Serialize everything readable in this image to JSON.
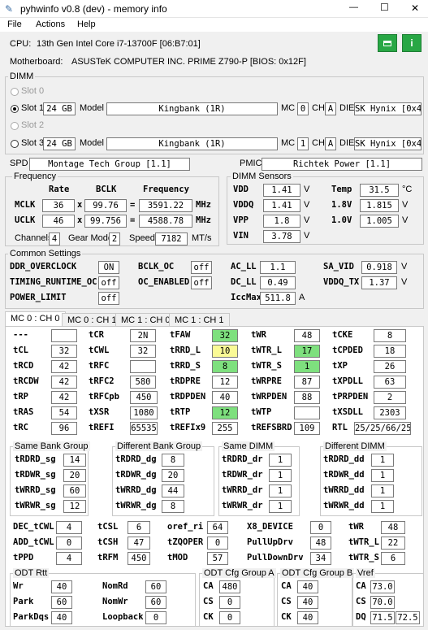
{
  "window": {
    "title": "pyhwinfo v0.8 (dev) - memory info",
    "minimize": "—",
    "maximize": "☐",
    "close": "✕"
  },
  "menu": [
    "File",
    "Actions",
    "Help"
  ],
  "cpu": {
    "label": "CPU:",
    "value": "13th Gen Intel Core i7-13700F  [06:B7:01]"
  },
  "motherboard": {
    "label": "Motherboard:",
    "value": "ASUSTeK COMPUTER INC. PRIME Z790-P  [BIOS: 0x12F]"
  },
  "toolbar": {
    "save_icon": "save-icon",
    "info_icon": "info-icon",
    "accent": "#28a745"
  },
  "dimm": {
    "title": "DIMM",
    "slots": [
      {
        "label": "Slot 0",
        "enabled": false
      },
      {
        "label": "Slot 1",
        "enabled": true,
        "selected": true,
        "size": "24 GB",
        "model_label": "Model",
        "model": "Kingbank          (1R)",
        "mc_label": "MC",
        "mc": "0",
        "ch_label": "CH",
        "ch": "A",
        "die_label": "DIE",
        "die": "SK Hynix [0x4D]"
      },
      {
        "label": "Slot 2",
        "enabled": false
      },
      {
        "label": "Slot 3",
        "enabled": true,
        "selected": false,
        "size": "24 GB",
        "model_label": "Model",
        "model": "Kingbank          (1R)",
        "mc_label": "MC",
        "mc": "1",
        "ch_label": "CH",
        "ch": "A",
        "die_label": "DIE",
        "die": "SK Hynix [0x4D]"
      }
    ]
  },
  "spd": {
    "label": "SPD",
    "value": "Montage Tech Group [1.1]"
  },
  "pmic": {
    "label": "PMIC",
    "value": "Richtek Power [1.1]"
  },
  "frequency": {
    "title": "Frequency",
    "col_rate": "Rate",
    "col_bclk": "BCLK",
    "col_freq": "Frequency",
    "rows": [
      {
        "label": "MCLK",
        "rate": "36",
        "x": "x",
        "bclk": "99.76",
        "eq": "=",
        "freq": "3591.22",
        "unit": "MHz"
      },
      {
        "label": "UCLK",
        "rate": "46",
        "x": "x",
        "bclk": "99.756",
        "eq": "=",
        "freq": "4588.78",
        "unit": "MHz"
      }
    ],
    "channels_label": "Channels",
    "channels": "4",
    "gear_label": "Gear Mode",
    "gear": "2",
    "speed_label": "Speed",
    "speed": "7182",
    "speed_unit": "MT/s"
  },
  "sensors": {
    "title": "DIMM Sensors",
    "items": [
      {
        "label": "VDD",
        "value": "1.41",
        "unit": "V"
      },
      {
        "label": "Temp",
        "value": "31.5",
        "unit": "°C"
      },
      {
        "label": "VDDQ",
        "value": "1.41",
        "unit": "V"
      },
      {
        "label": "1.8V",
        "value": "1.815",
        "unit": "V"
      },
      {
        "label": "VPP",
        "value": "1.8",
        "unit": "V"
      },
      {
        "label": "1.0V",
        "value": "1.005",
        "unit": "V"
      },
      {
        "label": "VIN",
        "value": "3.78",
        "unit": "V"
      }
    ]
  },
  "common": {
    "title": "Common Settings",
    "items": [
      {
        "label": "DDR_OVERCLOCK",
        "value": "ON"
      },
      {
        "label": "BCLK_OC",
        "value": "off"
      },
      {
        "label": "AC_LL",
        "value": "1.1"
      },
      {
        "label": "SA_VID",
        "value": "0.918",
        "unit": "V"
      },
      {
        "label": "TIMING_RUNTIME_OC",
        "value": "off"
      },
      {
        "label": "OC_ENABLED",
        "value": "off"
      },
      {
        "label": "DC_LL",
        "value": "0.49"
      },
      {
        "label": "VDDQ_TX",
        "value": "1.37",
        "unit": "V"
      },
      {
        "label": "POWER_LIMIT",
        "value": "off"
      },
      {
        "label": "IccMax",
        "value": "511.8",
        "unit": "A"
      }
    ]
  },
  "tabs": [
    "MC 0 : CH 0",
    "MC 0 : CH 1",
    "MC 1 : CH 0",
    "MC 1 : CH 1"
  ],
  "timings": [
    [
      {
        "l": "---",
        "v": ""
      },
      {
        "l": "tCR",
        "v": "2N"
      },
      {
        "l": "tFAW",
        "v": "32",
        "c": "g"
      },
      {
        "l": "tWR",
        "v": "48"
      },
      {
        "l": "tCKE",
        "v": "8"
      }
    ],
    [
      {
        "l": "tCL",
        "v": "32"
      },
      {
        "l": "tCWL",
        "v": "32"
      },
      {
        "l": "tRRD_L",
        "v": "10",
        "c": "y"
      },
      {
        "l": "tWTR_L",
        "v": "17",
        "c": "g"
      },
      {
        "l": "tCPDED",
        "v": "18"
      }
    ],
    [
      {
        "l": "tRCD",
        "v": "42"
      },
      {
        "l": "tRFC",
        "v": ""
      },
      {
        "l": "tRRD_S",
        "v": "8",
        "c": "g"
      },
      {
        "l": "tWTR_S",
        "v": "1",
        "c": "g"
      },
      {
        "l": "tXP",
        "v": "26"
      }
    ],
    [
      {
        "l": "tRCDW",
        "v": "42"
      },
      {
        "l": "tRFC2",
        "v": "580"
      },
      {
        "l": "tRDPRE",
        "v": "12"
      },
      {
        "l": "tWRPRE",
        "v": "87"
      },
      {
        "l": "tXPDLL",
        "v": "63"
      }
    ],
    [
      {
        "l": "tRP",
        "v": "42"
      },
      {
        "l": "tRFCpb",
        "v": "450"
      },
      {
        "l": "tRDPDEN",
        "v": "40"
      },
      {
        "l": "tWRPDEN",
        "v": "88"
      },
      {
        "l": "tPRPDEN",
        "v": "2"
      }
    ],
    [
      {
        "l": "tRAS",
        "v": "54"
      },
      {
        "l": "tXSR",
        "v": "1080"
      },
      {
        "l": "tRTP",
        "v": "12",
        "c": "g"
      },
      {
        "l": "tWTP",
        "v": ""
      },
      {
        "l": "tXSDLL",
        "v": "2303"
      }
    ],
    [
      {
        "l": "tRC",
        "v": "96"
      },
      {
        "l": "tREFI",
        "v": "65535"
      },
      {
        "l": "tREFIx9",
        "v": "255"
      },
      {
        "l": "tREFSBRD",
        "v": "109"
      },
      {
        "l": "RTL",
        "v": "25/25/66/25"
      }
    ]
  ],
  "sbg": {
    "title": "Same Bank Group",
    "items": [
      {
        "l": "tRDRD_sg",
        "v": "14"
      },
      {
        "l": "tRDWR_sg",
        "v": "20"
      },
      {
        "l": "tWRRD_sg",
        "v": "60"
      },
      {
        "l": "tWRWR_sg",
        "v": "12"
      }
    ]
  },
  "dbg": {
    "title": "Different Bank Group",
    "items": [
      {
        "l": "tRDRD_dg",
        "v": "8"
      },
      {
        "l": "tRDWR_dg",
        "v": "20"
      },
      {
        "l": "tWRRD_dg",
        "v": "44"
      },
      {
        "l": "tWRWR_dg",
        "v": "8"
      }
    ]
  },
  "sdimm": {
    "title": "Same DIMM",
    "items": [
      {
        "l": "tRDRD_dr",
        "v": "1"
      },
      {
        "l": "tRDWR_dr",
        "v": "1"
      },
      {
        "l": "tWRRD_dr",
        "v": "1"
      },
      {
        "l": "tWRWR_dr",
        "v": "1"
      }
    ]
  },
  "ddimm": {
    "title": "Different DIMM",
    "items": [
      {
        "l": "tRDRD_dd",
        "v": "1"
      },
      {
        "l": "tRDWR_dd",
        "v": "1"
      },
      {
        "l": "tWRRD_dd",
        "v": "1"
      },
      {
        "l": "tWRWR_dd",
        "v": "1"
      }
    ]
  },
  "misc": [
    [
      {
        "l": "DEC_tCWL",
        "v": "4"
      },
      {
        "l": "tCSL",
        "v": "6"
      },
      {
        "l": "oref_ri",
        "v": "64"
      },
      {
        "l": "X8_DEVICE",
        "v": "0"
      },
      {
        "l": "tWR",
        "v": "48"
      }
    ],
    [
      {
        "l": "ADD_tCWL",
        "v": "0"
      },
      {
        "l": "tCSH",
        "v": "47"
      },
      {
        "l": "tZQOPER",
        "v": "0"
      },
      {
        "l": "PullUpDrv",
        "v": "48"
      },
      {
        "l": "tWTR_L",
        "v": "22"
      }
    ],
    [
      {
        "l": "tPPD",
        "v": "4"
      },
      {
        "l": "tRFM",
        "v": "450"
      },
      {
        "l": "tMOD",
        "v": "57"
      },
      {
        "l": "PullDownDrv",
        "v": "34"
      },
      {
        "l": "tWTR_S",
        "v": "6"
      }
    ]
  ],
  "odt_rtt": {
    "title": "ODT Rtt",
    "items": [
      {
        "l": "Wr",
        "v": "40"
      },
      {
        "l": "NomRd",
        "v": "60"
      },
      {
        "l": "Park",
        "v": "60"
      },
      {
        "l": "NomWr",
        "v": "60"
      },
      {
        "l": "ParkDqs",
        "v": "40"
      },
      {
        "l": "Loopback",
        "v": "0"
      }
    ]
  },
  "odt_a": {
    "title": "ODT Cfg Group A",
    "items": [
      {
        "l": "CA",
        "v": "480"
      },
      {
        "l": "CS",
        "v": "0"
      },
      {
        "l": "CK",
        "v": "0"
      }
    ]
  },
  "odt_b": {
    "title": "ODT Cfg Group B",
    "items": [
      {
        "l": "CA",
        "v": "40"
      },
      {
        "l": "CS",
        "v": "40"
      },
      {
        "l": "CK",
        "v": "40"
      }
    ]
  },
  "vref": {
    "title": "Vref",
    "items": [
      {
        "l": "CA",
        "v": "73.0"
      },
      {
        "l": "CS",
        "v": "70.0"
      },
      {
        "l": "DQ",
        "v": "71.5",
        "v2": "72.5"
      }
    ]
  }
}
